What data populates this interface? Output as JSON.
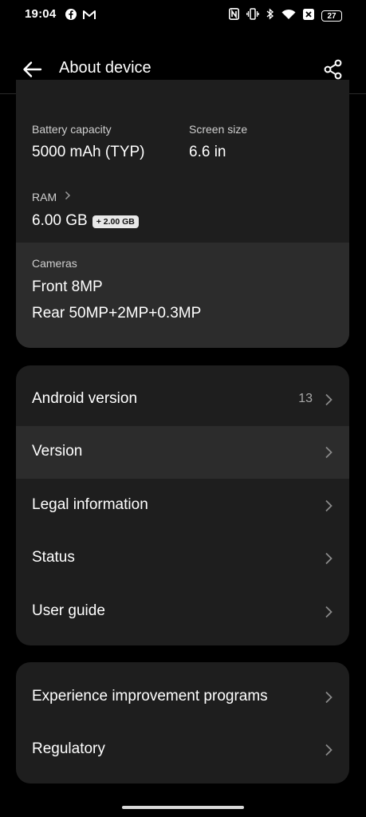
{
  "status_bar": {
    "time": "19:04",
    "battery_level": "27",
    "left_icons": [
      "facebook-icon",
      "gmail-icon"
    ],
    "right_icons": [
      "nfc-icon",
      "vibrate-icon",
      "bluetooth-icon",
      "wifi-icon",
      "no-sim-icon",
      "battery-icon"
    ]
  },
  "app_bar": {
    "title": "About device"
  },
  "specs": {
    "battery": {
      "label": "Battery capacity",
      "value": "5000 mAh (TYP)"
    },
    "screen": {
      "label": "Screen size",
      "value": "6.6 in"
    },
    "ram": {
      "label": "RAM",
      "value": "6.00 GB",
      "chip": "+ 2.00 GB"
    },
    "cameras": {
      "label": "Cameras",
      "front": "Front 8MP",
      "rear": "Rear 50MP+2MP+0.3MP"
    }
  },
  "menu_group_1": [
    {
      "label": "Android version",
      "value": "13"
    },
    {
      "label": "Version",
      "value": ""
    },
    {
      "label": "Legal information",
      "value": ""
    },
    {
      "label": "Status",
      "value": ""
    },
    {
      "label": "User guide",
      "value": ""
    }
  ],
  "menu_group_2": [
    {
      "label": "Experience improvement programs"
    },
    {
      "label": "Regulatory"
    }
  ],
  "colors": {
    "background": "#000000",
    "card": "#1e1e1e",
    "card_highlight": "#2c2c2c",
    "secondary_text": "#a8a8a8"
  }
}
